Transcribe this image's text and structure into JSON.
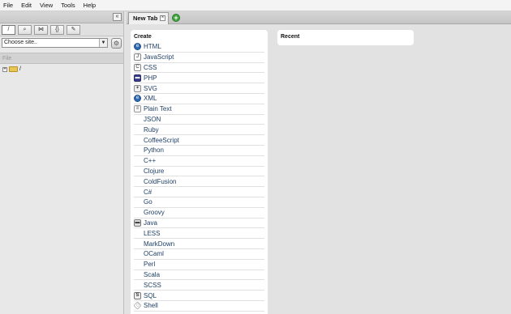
{
  "menu": [
    "File",
    "Edit",
    "View",
    "Tools",
    "Help"
  ],
  "left_panel": {
    "collapse_symbol": "«",
    "tools": [
      {
        "glyph": "/",
        "icon": "root-icon"
      },
      {
        "glyph": "⌕",
        "icon": "search-icon"
      },
      {
        "glyph": "⋈",
        "icon": "connection-icon"
      },
      {
        "glyph": "{}",
        "icon": "snippets-icon"
      },
      {
        "glyph": "✎",
        "icon": "edit-icon"
      }
    ],
    "site_select": {
      "value": "Choose site.."
    },
    "file_header": "File",
    "tree_root": "/"
  },
  "tabs": {
    "active_label": "New Tab",
    "close_symbol": "×",
    "add_symbol": "+"
  },
  "create": {
    "title": "Create",
    "items": [
      {
        "label": "HTML",
        "icon": "globe",
        "glyph": "e"
      },
      {
        "label": "JavaScript",
        "icon": "doc",
        "glyph": "J"
      },
      {
        "label": "CSS",
        "icon": "doc",
        "glyph": "C"
      },
      {
        "label": "PHP",
        "icon": "php",
        "glyph": "▬"
      },
      {
        "label": "SVG",
        "icon": "svg",
        "glyph": "✦"
      },
      {
        "label": "XML",
        "icon": "globe",
        "glyph": "e"
      },
      {
        "label": "Plain Text",
        "icon": "txt",
        "glyph": "≡"
      },
      {
        "label": "JSON",
        "icon": "none",
        "glyph": ""
      },
      {
        "label": "Ruby",
        "icon": "none",
        "glyph": ""
      },
      {
        "label": "CoffeeScript",
        "icon": "none",
        "glyph": ""
      },
      {
        "label": "Python",
        "icon": "none",
        "glyph": ""
      },
      {
        "label": "C++",
        "icon": "none",
        "glyph": ""
      },
      {
        "label": "Clojure",
        "icon": "none",
        "glyph": ""
      },
      {
        "label": "ColdFusion",
        "icon": "none",
        "glyph": ""
      },
      {
        "label": "C#",
        "icon": "none",
        "glyph": ""
      },
      {
        "label": "Go",
        "icon": "none",
        "glyph": ""
      },
      {
        "label": "Groovy",
        "icon": "none",
        "glyph": ""
      },
      {
        "label": "Java",
        "icon": "java",
        "glyph": "▬"
      },
      {
        "label": "LESS",
        "icon": "none",
        "glyph": ""
      },
      {
        "label": "MarkDown",
        "icon": "none",
        "glyph": ""
      },
      {
        "label": "OCaml",
        "icon": "none",
        "glyph": ""
      },
      {
        "label": "Perl",
        "icon": "none",
        "glyph": ""
      },
      {
        "label": "Scala",
        "icon": "none",
        "glyph": ""
      },
      {
        "label": "SCSS",
        "icon": "none",
        "glyph": ""
      },
      {
        "label": "SQL",
        "icon": "sql",
        "glyph": "S"
      },
      {
        "label": "Shell",
        "icon": "shell",
        "glyph": "◇"
      }
    ]
  },
  "recent": {
    "title": "Recent"
  }
}
